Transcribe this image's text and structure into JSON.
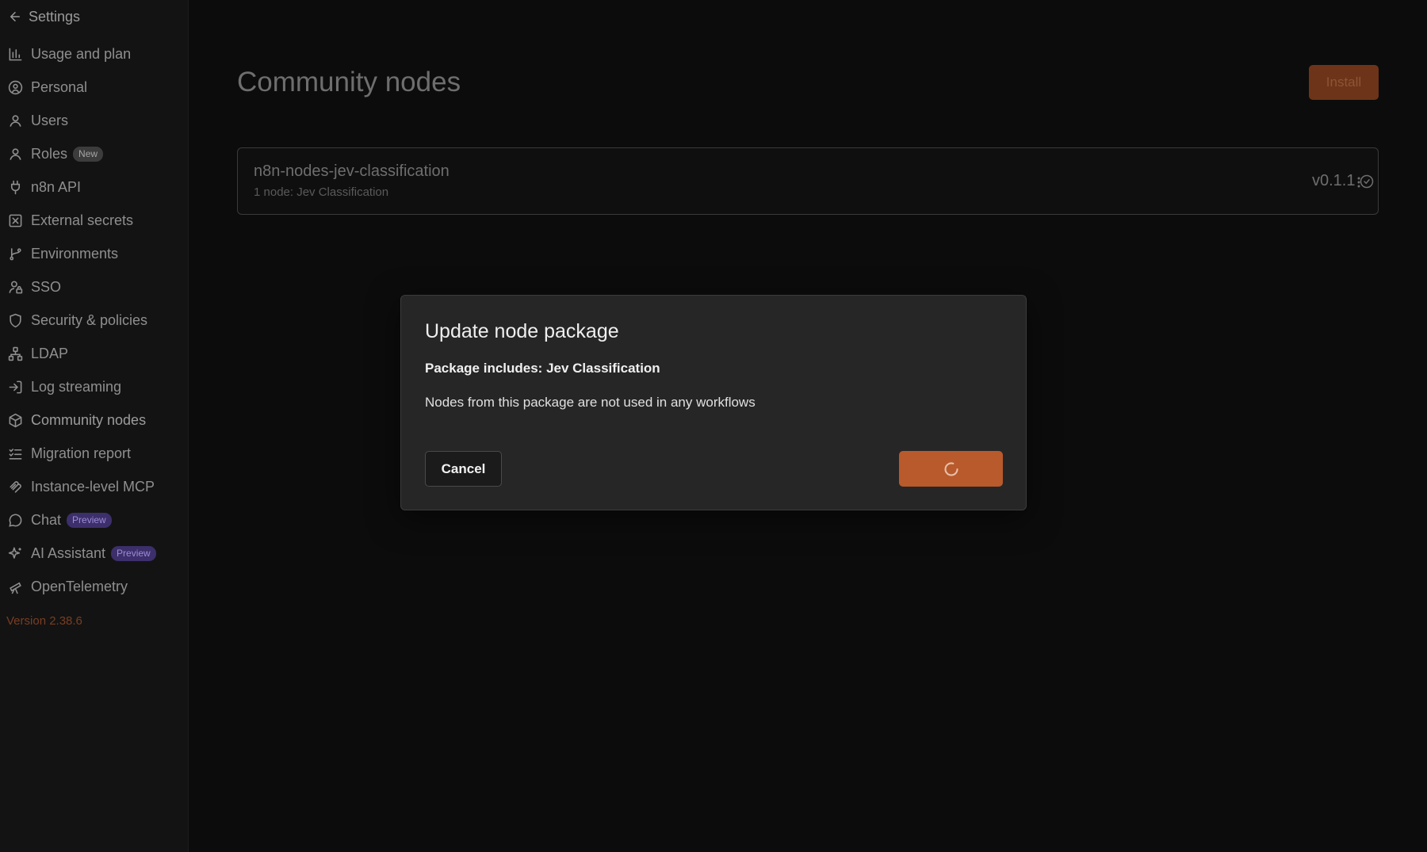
{
  "sidebar": {
    "back_label": "Settings",
    "items": [
      {
        "label": "Usage and plan",
        "icon": "bar-chart-icon"
      },
      {
        "label": "Personal",
        "icon": "user-circle-icon"
      },
      {
        "label": "Users",
        "icon": "user-icon"
      },
      {
        "label": "Roles",
        "icon": "user-icon",
        "badge": "New"
      },
      {
        "label": "n8n API",
        "icon": "plug-icon"
      },
      {
        "label": "External secrets",
        "icon": "square-x-icon"
      },
      {
        "label": "Environments",
        "icon": "git-branch-icon"
      },
      {
        "label": "SSO",
        "icon": "user-lock-icon"
      },
      {
        "label": "Security & policies",
        "icon": "shield-icon"
      },
      {
        "label": "LDAP",
        "icon": "network-icon"
      },
      {
        "label": "Log streaming",
        "icon": "log-in-icon"
      },
      {
        "label": "Community nodes",
        "icon": "box-icon"
      },
      {
        "label": "Migration report",
        "icon": "list-checks-icon"
      },
      {
        "label": "Instance-level MCP",
        "icon": "mcp-icon"
      },
      {
        "label": "Chat",
        "icon": "message-circle-icon",
        "badge": "Preview"
      },
      {
        "label": "AI Assistant",
        "icon": "sparkles-icon",
        "badge": "Preview"
      },
      {
        "label": "OpenTelemetry",
        "icon": "telescope-icon"
      }
    ],
    "version": "Version 2.38.6"
  },
  "main": {
    "title": "Community nodes",
    "install_label": "Install",
    "package": {
      "name": "n8n-nodes-jev-classification",
      "subtitle": "1 node:  Jev Classification",
      "version": "v0.1.1"
    }
  },
  "modal": {
    "title": "Update node package",
    "includes": "Package includes: Jev Classification",
    "note": "Nodes from this package are not used in any workflows",
    "cancel_label": "Cancel"
  },
  "colors": {
    "accent": "#b85a2c",
    "accent_dim": "#6d3419",
    "version_text": "#7a3d22",
    "preview_badge": "#3c2f6b"
  }
}
